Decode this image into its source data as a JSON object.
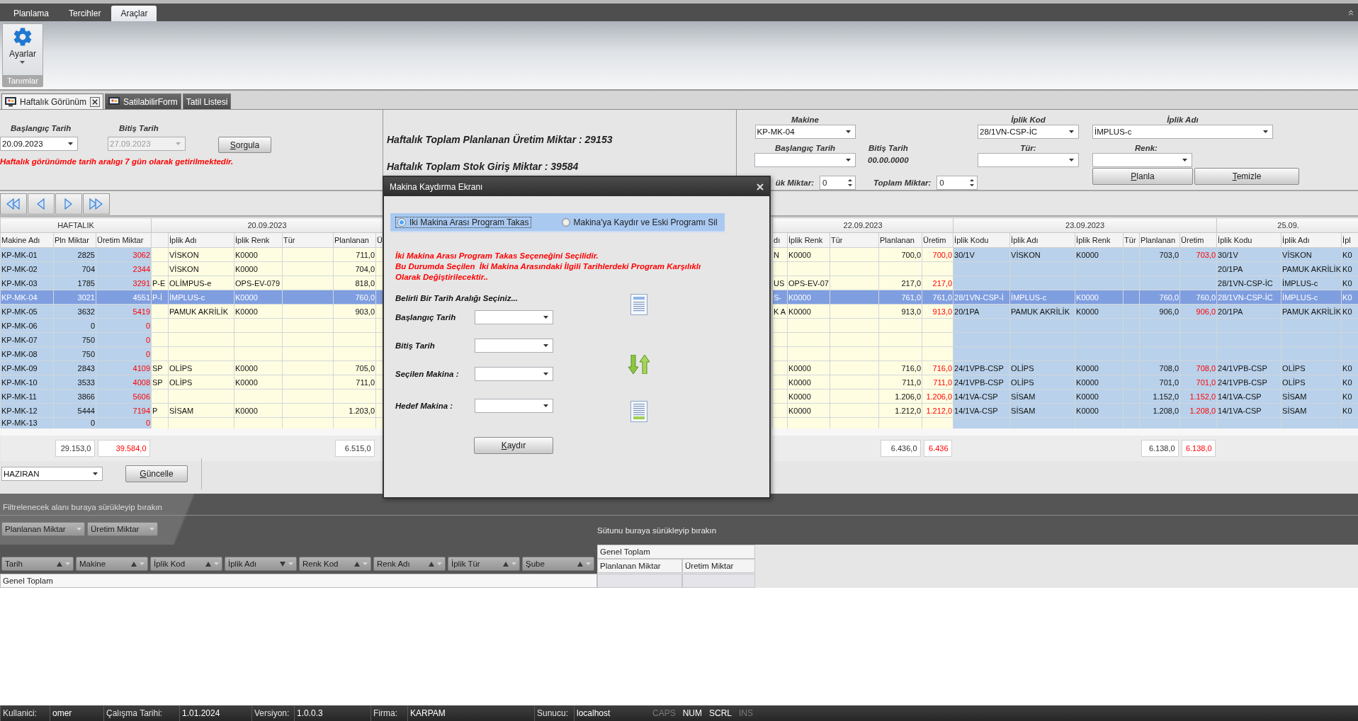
{
  "ribbon": {
    "tabs": [
      {
        "label": "Planlama",
        "selected": false
      },
      {
        "label": "Tercihler",
        "selected": false
      },
      {
        "label": "Araçlar",
        "selected": true
      }
    ],
    "groups": [
      {
        "label": "Tanımlar",
        "buttons": [
          {
            "label": "Ayarlar"
          }
        ]
      }
    ]
  },
  "document_tabs": [
    {
      "label": "Haftalık Görünüm",
      "selected": true,
      "closable": true,
      "has_icon": true
    },
    {
      "label": "SatilabilirForm",
      "selected": false,
      "closable": false,
      "has_icon": true
    },
    {
      "label": "Tatil Listesi",
      "selected": false,
      "closable": false,
      "has_icon": false
    }
  ],
  "query": {
    "start_label": "Başlangıç Tarih",
    "start_value": "20.09.2023",
    "end_label": "Bitiş Tarih",
    "end_value": "27.09.2023",
    "end_disabled": true,
    "button": "Sorgula",
    "note": "Haftalık görünümde tarih aralıgı 7 gün olarak getirilmektedir."
  },
  "totals_summary": [
    "Haftalık Toplam Planlanan Üretim Miktar : 29153",
    "Haftalık Toplam Stok Giriş Miktar : 39584"
  ],
  "planning": {
    "machine": {
      "label": "Makine",
      "value": "KP-MK-04"
    },
    "yarn_code": {
      "label": "İplik Kod",
      "value": "28/1VN-CSP-İC"
    },
    "yarn_name": {
      "label": "İplik Adı",
      "value": "İMPLUS-c"
    },
    "start_date": {
      "label": "Başlangıç Tarih"
    },
    "end_date": {
      "label": "Bitiş Tarih",
      "value": "00.00.0000"
    },
    "type": {
      "label": "Tür:"
    },
    "shade": {
      "label": "Renk:"
    },
    "load_amount": {
      "label": "ük Miktar:",
      "value": "0"
    },
    "total_amount": {
      "label": "Toplam Miktar:",
      "value": "0"
    },
    "buttons": [
      "Planla",
      "Temizle"
    ]
  },
  "grid": {
    "summary": {
      "header": "HAFTALIK",
      "color": "#b9d1ea",
      "columns": [
        {
          "header": "Makine Adı",
          "kind": "text"
        },
        {
          "header": "Pln Miktar",
          "kind": "number"
        },
        {
          "header": "Üretim Miktar",
          "kind": "output"
        }
      ]
    },
    "groups": [
      {
        "date": "20.09.2023",
        "color": "#fffde1",
        "columns": [
          {
            "kind": "text"
          },
          {
            "header": "İplik Adı",
            "kind": "text"
          },
          {
            "header": "İplik Renk",
            "kind": "text"
          },
          {
            "header": "Tür",
            "kind": "text"
          },
          {
            "header": "Planlanan",
            "kind": "number"
          },
          {
            "header": "Ü",
            "kind": "output"
          }
        ]
      },
      {
        "date": "22.09.2023",
        "color": "#fffde1",
        "columns": [
          {
            "header": "dı",
            "kind": "text"
          },
          {
            "header": "İplik Renk",
            "kind": "text"
          },
          {
            "header": "Tür",
            "kind": "text"
          },
          {
            "header": "Planlanan",
            "kind": "number"
          },
          {
            "header": "Üretim",
            "kind": "output"
          }
        ]
      },
      {
        "date": "23.09.2023",
        "color": "#b9d1ea",
        "columns": [
          {
            "header": "İplik Kodu",
            "kind": "text"
          },
          {
            "header": "İplik Adı",
            "kind": "text"
          },
          {
            "header": "İplik Renk",
            "kind": "text"
          },
          {
            "header": "Tür",
            "kind": "text"
          },
          {
            "header": "Planlanan",
            "kind": "number"
          },
          {
            "header": "Üretim",
            "kind": "output"
          }
        ]
      },
      {
        "date": "25.09.",
        "color": "#b9d1ea",
        "columns": [
          {
            "header": "İplik Kodu",
            "kind": "text"
          },
          {
            "header": "İplik Adı",
            "kind": "text"
          },
          {
            "header": "İpl",
            "kind": "text"
          }
        ]
      }
    ],
    "rows": [
      {
        "selected": false,
        "summary": [
          "KP-MK-01",
          "2825",
          "3062"
        ],
        "cells": [
          {
            "kind": "blank"
          },
          {
            "kind": "value",
            "text": "VİSKON"
          },
          {
            "kind": "value",
            "text": "K0000"
          },
          {
            "kind": "blank"
          },
          {
            "kind": "value",
            "text": "711,0"
          },
          {
            "kind": "blank"
          },
          {
            "kind": "value",
            "text": "N"
          },
          {
            "kind": "value",
            "text": "K0000"
          },
          {
            "kind": "blank"
          },
          {
            "kind": "value",
            "text": "700,0"
          },
          {
            "kind": "value",
            "text": "700,0"
          },
          {
            "kind": "value",
            "text": "30/1V"
          },
          {
            "kind": "value",
            "text": "VİSKON"
          },
          {
            "kind": "value",
            "text": "K0000"
          },
          {
            "kind": "blank"
          },
          {
            "kind": "value",
            "text": "703,0"
          },
          {
            "kind": "value",
            "text": "703,0"
          },
          {
            "kind": "value",
            "text": "30/1V"
          },
          {
            "kind": "value",
            "text": "VİSKON"
          },
          {
            "kind": "value",
            "text": "K0"
          }
        ]
      },
      {
        "selected": false,
        "summary": [
          "KP-MK-02",
          "704",
          "2344"
        ],
        "cells": [
          {
            "kind": "blank"
          },
          {
            "kind": "value",
            "text": "VİSKON"
          },
          {
            "kind": "value",
            "text": "K0000"
          },
          {
            "kind": "blank"
          },
          {
            "kind": "value",
            "text": "704,0"
          },
          {
            "kind": "blank"
          },
          {
            "kind": "blank"
          },
          {
            "kind": "blank"
          },
          {
            "kind": "blank"
          },
          {
            "kind": "blank"
          },
          {
            "kind": "blank"
          },
          {
            "kind": "blank"
          },
          {
            "kind": "blank"
          },
          {
            "kind": "blank"
          },
          {
            "kind": "blank"
          },
          {
            "kind": "blank"
          },
          {
            "kind": "blank"
          },
          {
            "kind": "value",
            "text": "20/1PA"
          },
          {
            "kind": "value",
            "text": "PAMUK AKRİLİK"
          },
          {
            "kind": "value",
            "text": "K0"
          }
        ]
      },
      {
        "selected": false,
        "summary": [
          "KP-MK-03",
          "1785",
          "3291"
        ],
        "cells": [
          {
            "kind": "value",
            "text": "P-E"
          },
          {
            "kind": "value",
            "text": "OLİMPUS-e"
          },
          {
            "kind": "value",
            "text": "OPS-EV-079"
          },
          {
            "kind": "blank"
          },
          {
            "kind": "value",
            "text": "818,0"
          },
          {
            "kind": "blank"
          },
          {
            "kind": "value",
            "text": "US"
          },
          {
            "kind": "value",
            "text": "OPS-EV-07"
          },
          {
            "kind": "blank"
          },
          {
            "kind": "value",
            "text": "217,0"
          },
          {
            "kind": "value",
            "text": "217,0"
          },
          {
            "kind": "blank"
          },
          {
            "kind": "blank"
          },
          {
            "kind": "blank"
          },
          {
            "kind": "blank"
          },
          {
            "kind": "blank"
          },
          {
            "kind": "blank"
          },
          {
            "kind": "value",
            "text": "28/1VN-CSP-İC"
          },
          {
            "kind": "value",
            "text": "İMPLUS-c"
          },
          {
            "kind": "value",
            "text": "K0"
          }
        ]
      },
      {
        "selected": true,
        "summary": [
          "KP-MK-04",
          "3021",
          "4551"
        ],
        "cells": [
          {
            "kind": "value",
            "text": "P-İ"
          },
          {
            "kind": "value",
            "text": "İMPLUS-c"
          },
          {
            "kind": "value",
            "text": "K0000"
          },
          {
            "kind": "blank"
          },
          {
            "kind": "value",
            "text": "760,0"
          },
          {
            "kind": "blank"
          },
          {
            "kind": "value",
            "text": "S-"
          },
          {
            "kind": "value",
            "text": "K0000"
          },
          {
            "kind": "blank"
          },
          {
            "kind": "value",
            "text": "761,0"
          },
          {
            "kind": "value",
            "text": "761,0"
          },
          {
            "kind": "value",
            "text": "28/1VN-CSP-İ"
          },
          {
            "kind": "value",
            "text": "İMPLUS-c"
          },
          {
            "kind": "value",
            "text": "K0000"
          },
          {
            "kind": "blank"
          },
          {
            "kind": "value",
            "text": "760,0"
          },
          {
            "kind": "value",
            "text": "760,0"
          },
          {
            "kind": "value",
            "text": "28/1VN-CSP-İC"
          },
          {
            "kind": "value",
            "text": "İMPLUS-c"
          },
          {
            "kind": "value",
            "text": "K0"
          }
        ]
      },
      {
        "selected": false,
        "summary": [
          "KP-MK-05",
          "3632",
          "5419"
        ],
        "cells": [
          {
            "kind": "blank"
          },
          {
            "kind": "value",
            "text": "PAMUK AKRİLİK"
          },
          {
            "kind": "value",
            "text": "K0000"
          },
          {
            "kind": "blank"
          },
          {
            "kind": "value",
            "text": "903,0"
          },
          {
            "kind": "blank"
          },
          {
            "kind": "value",
            "text": "K A"
          },
          {
            "kind": "value",
            "text": "K0000"
          },
          {
            "kind": "blank"
          },
          {
            "kind": "value",
            "text": "913,0"
          },
          {
            "kind": "value",
            "text": "913,0"
          },
          {
            "kind": "value",
            "text": "20/1PA"
          },
          {
            "kind": "value",
            "text": "PAMUK AKRİLİK"
          },
          {
            "kind": "value",
            "text": "K0000"
          },
          {
            "kind": "blank"
          },
          {
            "kind": "value",
            "text": "906,0"
          },
          {
            "kind": "value",
            "text": "906,0"
          },
          {
            "kind": "value",
            "text": "20/1PA"
          },
          {
            "kind": "value",
            "text": "PAMUK AKRİLİK"
          },
          {
            "kind": "value",
            "text": "K0"
          }
        ]
      },
      {
        "selected": false,
        "summary": [
          "KP-MK-06",
          "0",
          "0"
        ],
        "cells": [
          {
            "kind": "blank"
          },
          {
            "kind": "blank"
          },
          {
            "kind": "blank"
          },
          {
            "kind": "blank"
          },
          {
            "kind": "blank"
          },
          {
            "kind": "blank"
          },
          {
            "kind": "blank"
          },
          {
            "kind": "blank"
          },
          {
            "kind": "blank"
          },
          {
            "kind": "blank"
          },
          {
            "kind": "blank"
          },
          {
            "kind": "blank"
          },
          {
            "kind": "blank"
          },
          {
            "kind": "blank"
          },
          {
            "kind": "blank"
          },
          {
            "kind": "blank"
          },
          {
            "kind": "blank"
          },
          {
            "kind": "blank"
          },
          {
            "kind": "blank"
          },
          {
            "kind": "blank"
          }
        ]
      },
      {
        "selected": false,
        "summary": [
          "KP-MK-07",
          "750",
          "0"
        ],
        "cells": [
          {
            "kind": "blank"
          },
          {
            "kind": "blank"
          },
          {
            "kind": "blank"
          },
          {
            "kind": "blank"
          },
          {
            "kind": "blank"
          },
          {
            "kind": "blank"
          },
          {
            "kind": "blank"
          },
          {
            "kind": "blank"
          },
          {
            "kind": "blank"
          },
          {
            "kind": "blank"
          },
          {
            "kind": "blank"
          },
          {
            "kind": "blank"
          },
          {
            "kind": "blank"
          },
          {
            "kind": "blank"
          },
          {
            "kind": "blank"
          },
          {
            "kind": "blank"
          },
          {
            "kind": "blank"
          },
          {
            "kind": "blank"
          },
          {
            "kind": "blank"
          },
          {
            "kind": "blank"
          }
        ]
      },
      {
        "selected": false,
        "summary": [
          "KP-MK-08",
          "750",
          "0"
        ],
        "cells": [
          {
            "kind": "blank"
          },
          {
            "kind": "blank"
          },
          {
            "kind": "blank"
          },
          {
            "kind": "blank"
          },
          {
            "kind": "blank"
          },
          {
            "kind": "blank"
          },
          {
            "kind": "blank"
          },
          {
            "kind": "blank"
          },
          {
            "kind": "blank"
          },
          {
            "kind": "blank"
          },
          {
            "kind": "blank"
          },
          {
            "kind": "blank"
          },
          {
            "kind": "blank"
          },
          {
            "kind": "blank"
          },
          {
            "kind": "blank"
          },
          {
            "kind": "blank"
          },
          {
            "kind": "blank"
          },
          {
            "kind": "blank"
          },
          {
            "kind": "blank"
          },
          {
            "kind": "blank"
          }
        ]
      },
      {
        "selected": false,
        "summary": [
          "KP-MK-09",
          "2843",
          "4109"
        ],
        "cells": [
          {
            "kind": "value",
            "text": "SP"
          },
          {
            "kind": "value",
            "text": "OLİPS"
          },
          {
            "kind": "value",
            "text": "K0000"
          },
          {
            "kind": "blank"
          },
          {
            "kind": "value",
            "text": "705,0"
          },
          {
            "kind": "blank"
          },
          {
            "kind": "blank"
          },
          {
            "kind": "value",
            "text": "K0000"
          },
          {
            "kind": "blank"
          },
          {
            "kind": "value",
            "text": "716,0"
          },
          {
            "kind": "value",
            "text": "716,0"
          },
          {
            "kind": "value",
            "text": "24/1VPB-CSP"
          },
          {
            "kind": "value",
            "text": "OLİPS"
          },
          {
            "kind": "value",
            "text": "K0000"
          },
          {
            "kind": "blank"
          },
          {
            "kind": "value",
            "text": "708,0"
          },
          {
            "kind": "value",
            "text": "708,0"
          },
          {
            "kind": "value",
            "text": "24/1VPB-CSP"
          },
          {
            "kind": "value",
            "text": "OLİPS"
          },
          {
            "kind": "value",
            "text": "K0"
          }
        ]
      },
      {
        "selected": false,
        "summary": [
          "KP-MK-10",
          "3533",
          "4008"
        ],
        "cells": [
          {
            "kind": "value",
            "text": "SP"
          },
          {
            "kind": "value",
            "text": "OLİPS"
          },
          {
            "kind": "value",
            "text": "K0000"
          },
          {
            "kind": "blank"
          },
          {
            "kind": "value",
            "text": "711,0"
          },
          {
            "kind": "blank"
          },
          {
            "kind": "blank"
          },
          {
            "kind": "value",
            "text": "K0000"
          },
          {
            "kind": "blank"
          },
          {
            "kind": "value",
            "text": "711,0"
          },
          {
            "kind": "value",
            "text": "711,0"
          },
          {
            "kind": "value",
            "text": "24/1VPB-CSP"
          },
          {
            "kind": "value",
            "text": "OLİPS"
          },
          {
            "kind": "value",
            "text": "K0000"
          },
          {
            "kind": "blank"
          },
          {
            "kind": "value",
            "text": "701,0"
          },
          {
            "kind": "value",
            "text": "701,0"
          },
          {
            "kind": "value",
            "text": "24/1VPB-CSP"
          },
          {
            "kind": "value",
            "text": "OLİPS"
          },
          {
            "kind": "value",
            "text": "K0"
          }
        ]
      },
      {
        "selected": false,
        "summary": [
          "KP-MK-11",
          "3866",
          "5606"
        ],
        "cells": [
          {
            "kind": "blank"
          },
          {
            "kind": "blank"
          },
          {
            "kind": "blank"
          },
          {
            "kind": "blank"
          },
          {
            "kind": "blank"
          },
          {
            "kind": "blank"
          },
          {
            "kind": "blank"
          },
          {
            "kind": "value",
            "text": "K0000"
          },
          {
            "kind": "blank"
          },
          {
            "kind": "value",
            "text": "1.206,0"
          },
          {
            "kind": "value",
            "text": "1.206,0"
          },
          {
            "kind": "value",
            "text": "14/1VA-CSP"
          },
          {
            "kind": "value",
            "text": "SİSAM"
          },
          {
            "kind": "value",
            "text": "K0000"
          },
          {
            "kind": "blank"
          },
          {
            "kind": "value",
            "text": "1.152,0"
          },
          {
            "kind": "value",
            "text": "1.152,0"
          },
          {
            "kind": "value",
            "text": "14/1VA-CSP"
          },
          {
            "kind": "value",
            "text": "SİSAM"
          },
          {
            "kind": "value",
            "text": "K0"
          }
        ]
      },
      {
        "selected": false,
        "summary": [
          "KP-MK-12",
          "5444",
          "7194"
        ],
        "cells": [
          {
            "kind": "value",
            "text": "P"
          },
          {
            "kind": "value",
            "text": "SİSAM"
          },
          {
            "kind": "value",
            "text": "K0000"
          },
          {
            "kind": "blank"
          },
          {
            "kind": "value",
            "text": "1.203,0"
          },
          {
            "kind": "blank"
          },
          {
            "kind": "blank"
          },
          {
            "kind": "value",
            "text": "K0000"
          },
          {
            "kind": "blank"
          },
          {
            "kind": "value",
            "text": "1.212,0"
          },
          {
            "kind": "value",
            "text": "1.212,0"
          },
          {
            "kind": "value",
            "text": "14/1VA-CSP"
          },
          {
            "kind": "value",
            "text": "SİSAM"
          },
          {
            "kind": "value",
            "text": "K0000"
          },
          {
            "kind": "blank"
          },
          {
            "kind": "value",
            "text": "1.208,0"
          },
          {
            "kind": "value",
            "text": "1.208,0"
          },
          {
            "kind": "value",
            "text": "14/1VA-CSP"
          },
          {
            "kind": "value",
            "text": "SİSAM"
          },
          {
            "kind": "value",
            "text": "K0"
          }
        ]
      },
      {
        "selected": false,
        "summary": [
          "KP-MK-13",
          "0",
          "0"
        ],
        "cells": [
          {
            "kind": "blank"
          },
          {
            "kind": "blank"
          },
          {
            "kind": "blank"
          },
          {
            "kind": "blank"
          },
          {
            "kind": "blank"
          },
          {
            "kind": "blank"
          },
          {
            "kind": "blank"
          },
          {
            "kind": "blank"
          },
          {
            "kind": "blank"
          },
          {
            "kind": "blank"
          },
          {
            "kind": "blank"
          },
          {
            "kind": "blank"
          },
          {
            "kind": "blank"
          },
          {
            "kind": "blank"
          },
          {
            "kind": "blank"
          },
          {
            "kind": "blank"
          },
          {
            "kind": "blank"
          },
          {
            "kind": "blank"
          },
          {
            "kind": "blank"
          },
          {
            "kind": "blank"
          }
        ]
      }
    ],
    "totals": {
      "summary": [
        {
          "kind": "blank"
        },
        {
          "kind": "value",
          "text": "29.153,0"
        },
        {
          "kind": "value",
          "text": "39.584,0"
        }
      ],
      "cells": [
        {
          "kind": "blank"
        },
        {
          "kind": "blank"
        },
        {
          "kind": "blank"
        },
        {
          "kind": "blank"
        },
        {
          "kind": "value",
          "text": "6.515,0"
        },
        {
          "kind": "blank"
        },
        {
          "kind": "blank"
        },
        {
          "kind": "blank"
        },
        {
          "kind": "blank"
        },
        {
          "kind": "value",
          "text": "6.436,0"
        },
        {
          "kind": "value",
          "text": "6.436"
        },
        {
          "kind": "blank"
        },
        {
          "kind": "blank"
        },
        {
          "kind": "blank"
        },
        {
          "kind": "blank"
        },
        {
          "kind": "value",
          "text": "6.138,0"
        },
        {
          "kind": "value",
          "text": "6.138,0"
        },
        {
          "kind": "blank"
        },
        {
          "kind": "blank"
        },
        {
          "kind": "blank"
        }
      ]
    }
  },
  "bottom_controls": {
    "month": "HAZIRAN",
    "button": "Güncelle"
  },
  "pivot": {
    "filter_hint": "Filtrelenecek alanı buraya sürükleyip bırakın",
    "data_fields": [
      "Planlanan Miktar",
      "Üretim Miktar"
    ],
    "column_hint": "Sütunu buraya sürükleyip bırakın",
    "row_fields": [
      {
        "label": "Tarih",
        "sort_descending": false
      },
      {
        "label": "Makine",
        "sort_descending": false
      },
      {
        "label": "İplik Kod",
        "sort_descending": false
      },
      {
        "label": "İplik Adı",
        "sort_descending": true
      },
      {
        "label": "Renk Kod",
        "sort_descending": false
      },
      {
        "label": "Renk Adı",
        "sort_descending": false
      },
      {
        "label": "İplik Tür",
        "sort_descending": false
      },
      {
        "label": "Şube",
        "sort_descending": false
      }
    ],
    "row_total": "Genel Toplam",
    "column_total": "Genel Toplam",
    "value_headers": [
      "Planlanan Miktar",
      "Üretim Miktar"
    ]
  },
  "status_bar": {
    "items": [
      {
        "label": "Kullanici:",
        "value": "omer"
      },
      {
        "label": "Çalışma Tarihi:",
        "value": "1.01.2024"
      },
      {
        "label": "Versiyon:",
        "value": "1.0.0.3"
      },
      {
        "label": "Firma:",
        "value": "KARPAM"
      },
      {
        "label": "Sunucu:",
        "value": "localhost"
      }
    ],
    "indicators": [
      {
        "text": "CAPS",
        "on": false
      },
      {
        "text": "NUM",
        "on": true
      },
      {
        "text": "SCRL",
        "on": true
      },
      {
        "text": "INS",
        "on": false
      }
    ]
  },
  "dialog": {
    "title": "Makina Kaydırma Ekranı",
    "options": [
      {
        "label": "Iki Makina Arası Program Takas",
        "selected": true
      },
      {
        "label": "Makina'ya Kaydır ve Eski Programı Sil",
        "selected": false
      }
    ],
    "notice_lines": [
      "İki Makina Arası Program Takas Seçeneğini Seçilidir.",
      "Bu Durumda Seçilen  İki Makina Arasındaki İlgili Tarihlerdeki Program Karşılıklı",
      "Olarak Değiştirilecektir.."
    ],
    "range_prompt": "Belirli Bir Tarih Aralığı Seçiniz...",
    "fields": [
      {
        "label": "Başlangıç Tarih"
      },
      {
        "label": "Bitiş Tarih"
      },
      {
        "label": "Seçilen Makina :"
      },
      {
        "label": "Hedef Makina :"
      }
    ],
    "button": "Kaydır"
  }
}
